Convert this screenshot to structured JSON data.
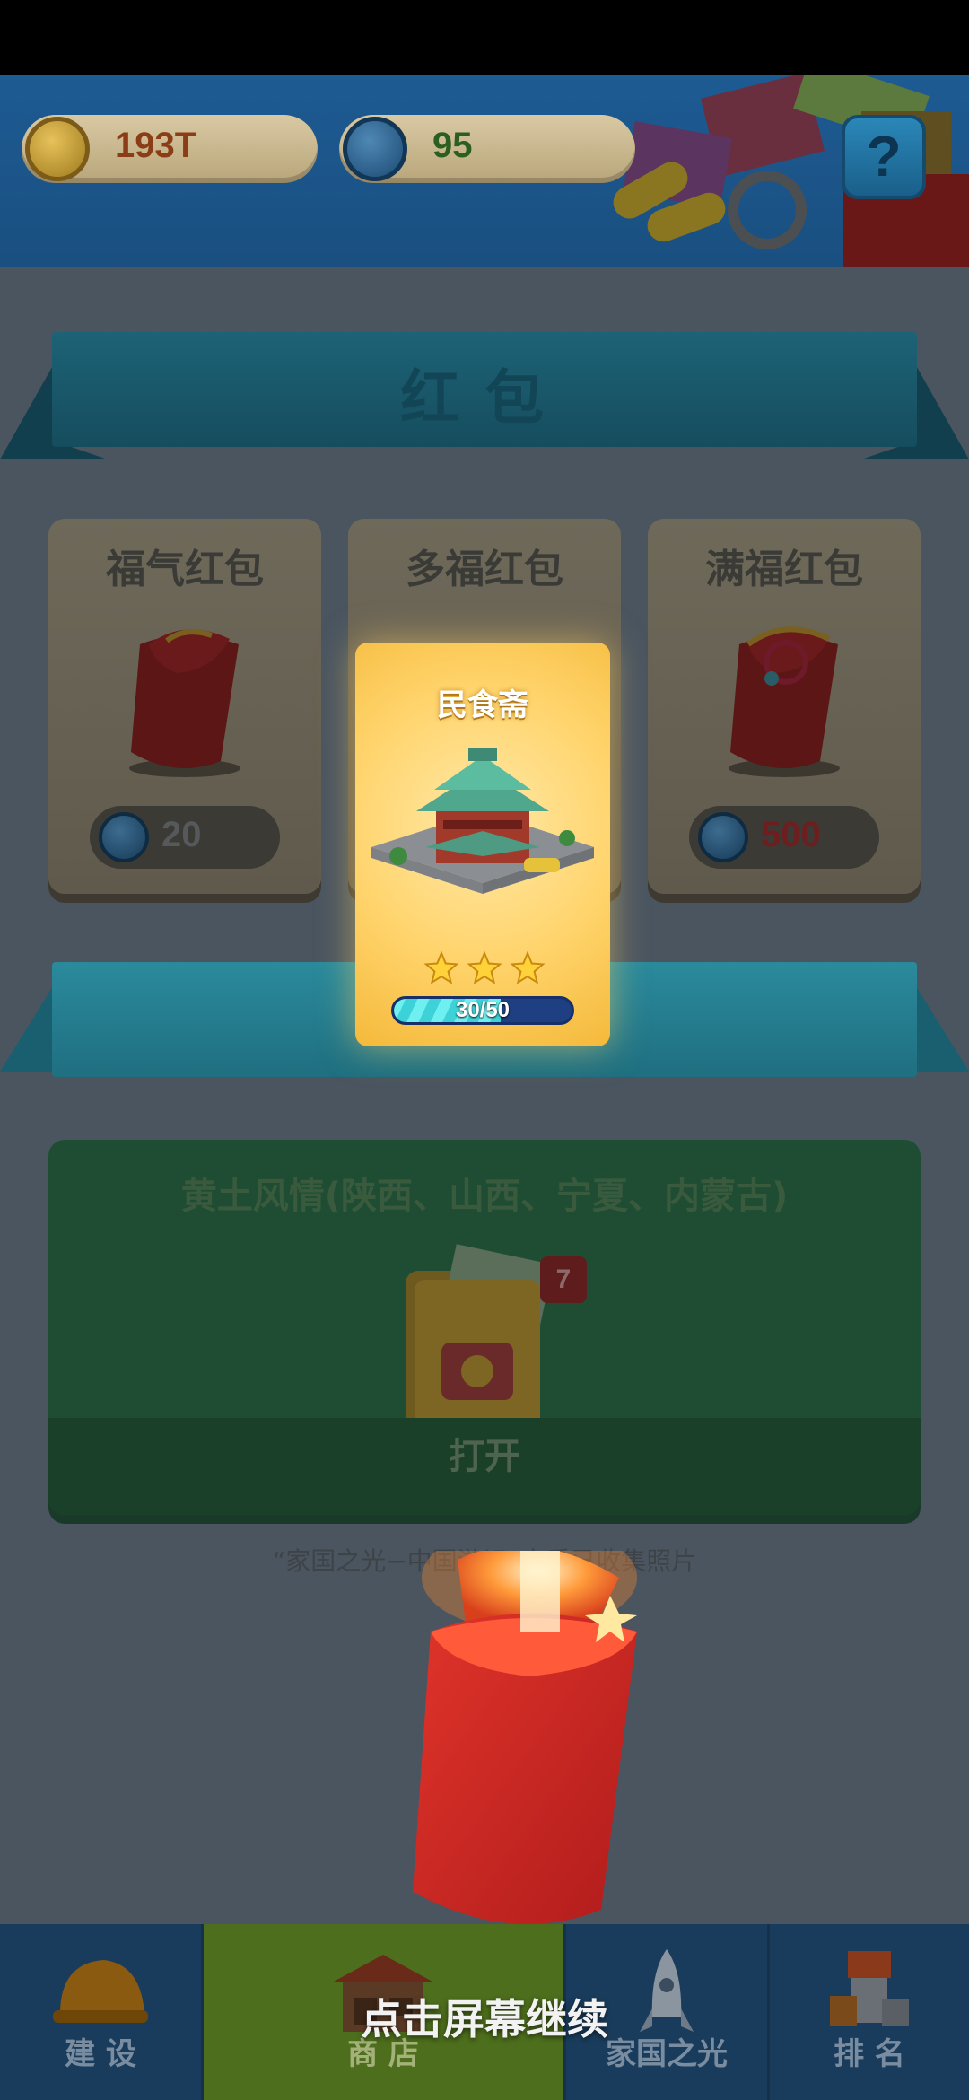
{
  "header": {
    "coins": "193T",
    "gems": "95",
    "help_label": "?"
  },
  "main": {
    "red_packet_title": "红包",
    "packets": [
      {
        "name": "福气红包",
        "price": "20"
      },
      {
        "name": "多福红包",
        "price": ""
      },
      {
        "name": "满福红包",
        "price": "500"
      }
    ],
    "album": {
      "title": "黄土风情(陕西、山西、宁夏、内蒙古)",
      "badge": "7",
      "open_label": "打开"
    },
    "hint": "“家国之光−中国游记”查看已收集照片"
  },
  "reward": {
    "building_name": "民食斋",
    "stars": 3,
    "progress_text": "30/50",
    "progress_fraction": 0.6
  },
  "nav": {
    "items": [
      {
        "label": "建 设"
      },
      {
        "label": "商 店"
      },
      {
        "label": "家国之光"
      },
      {
        "label": "排 名"
      }
    ]
  },
  "continue_prompt": "点击屏幕继续"
}
